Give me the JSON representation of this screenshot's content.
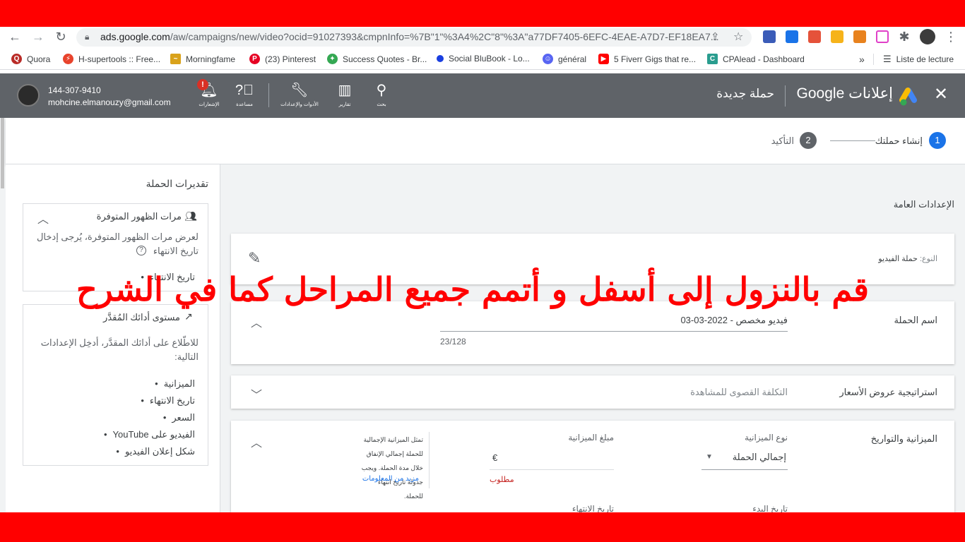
{
  "browser": {
    "url_main": "ads.google.com",
    "url_rest": "/aw/campaigns/new/video?ocid=91027393&cmpnInfo=%7B\"1\"%3A4%2C\"8\"%3A\"a77DF7405-6EFC-4EAE-A7D7-EF18EA7...",
    "bookmarks": [
      {
        "label": "Quora",
        "icon": "quora-icon",
        "color": "#b92b27"
      },
      {
        "label": "H-supertools :: Free...",
        "icon": "h-supertools-icon",
        "color": "#e8432c"
      },
      {
        "label": "Morningfame",
        "icon": "morningfame-icon",
        "color": "#d9a21b"
      },
      {
        "label": "(23) Pinterest",
        "icon": "pinterest-icon",
        "color": "#e60023"
      },
      {
        "label": "Success Quotes - Br...",
        "icon": "pinwheel-icon",
        "color": "#34a853"
      },
      {
        "label": "Social BluBook - Lo...",
        "icon": "dot-icon",
        "color": "#1a3fe0"
      },
      {
        "label": "général",
        "icon": "discord-icon",
        "color": "#5865f2"
      },
      {
        "label": "5 Fiverr Gigs that re...",
        "icon": "youtube-icon",
        "color": "#ff0000"
      },
      {
        "label": "CPAlead - Dashboard",
        "icon": "cpalead-icon",
        "color": "#2a9d8f"
      }
    ],
    "reading_list": "Liste de lecture"
  },
  "header": {
    "phone": "144-307-9410",
    "email": "mohcine.elmanouzy@gmail.com",
    "notifications_label": "الإشعارات",
    "help_label": "مساعدة",
    "tools_label": "الأدوات والإعدادات",
    "reports_label": "تقارير",
    "search_label": "بحث",
    "page_title": "حملة جديدة",
    "brand": "إعلانات Google"
  },
  "stepper": {
    "step1_num": "1",
    "step1_label": "إنشاء حملتك",
    "step2_num": "2",
    "step2_label": "التأكيد"
  },
  "sidebar": {
    "title": "تقديرات الحملة",
    "impressions": {
      "title": "مرات الظهور المتوفرة",
      "desc": "لعرض مرات الظهور المتوفرة، يُرجى إدخال تاريخ الانتهاء",
      "items": [
        "تاريخ الانتهاء"
      ]
    },
    "performance": {
      "title": "مستوى أدائك المُقدَّر",
      "desc": "للاطّلاع على أدائك المقدَّر، أدخِل الإعدادات التالية:",
      "items": [
        "الميزانية",
        "تاريخ الانتهاء",
        "السعر",
        "الفيديو على YouTube",
        "شكل إعلان الفيديو"
      ]
    }
  },
  "main": {
    "section_title": "الإعدادات العامة",
    "type_label": "النوع:",
    "type_value": "حملة الفيديو",
    "campaign_name_label": "اسم الحملة",
    "campaign_name_value": "فيديو مخصص - 2022-03-03",
    "char_count": "23/128",
    "bidding_label": "استراتيجية عروض الأسعار",
    "bidding_value": "التكلفة القصوى للمشاهدة",
    "budget_section_label": "الميزانية والتواريخ",
    "budget_type_label": "نوع الميزانية",
    "budget_type_value": "إجمالي الحملة",
    "budget_amount_label": "مبلغ الميزانية",
    "currency": "€",
    "required": "مطلوب",
    "help_text": "تمثل الميزانية الإجمالية للحملة إجمالي الإنفاق خلال مدة الحملة. ويجب جدولة تاريخ انتهاء للحملة.",
    "learn_more": "مزيد من المعلومات",
    "start_date_label": "تاريخ البدء",
    "end_date_label": "تاريخ الانتهاء"
  },
  "overlay_text": "قم بالنزول إلى أسفل و أتمم جميع المراحل كما في الشرح"
}
